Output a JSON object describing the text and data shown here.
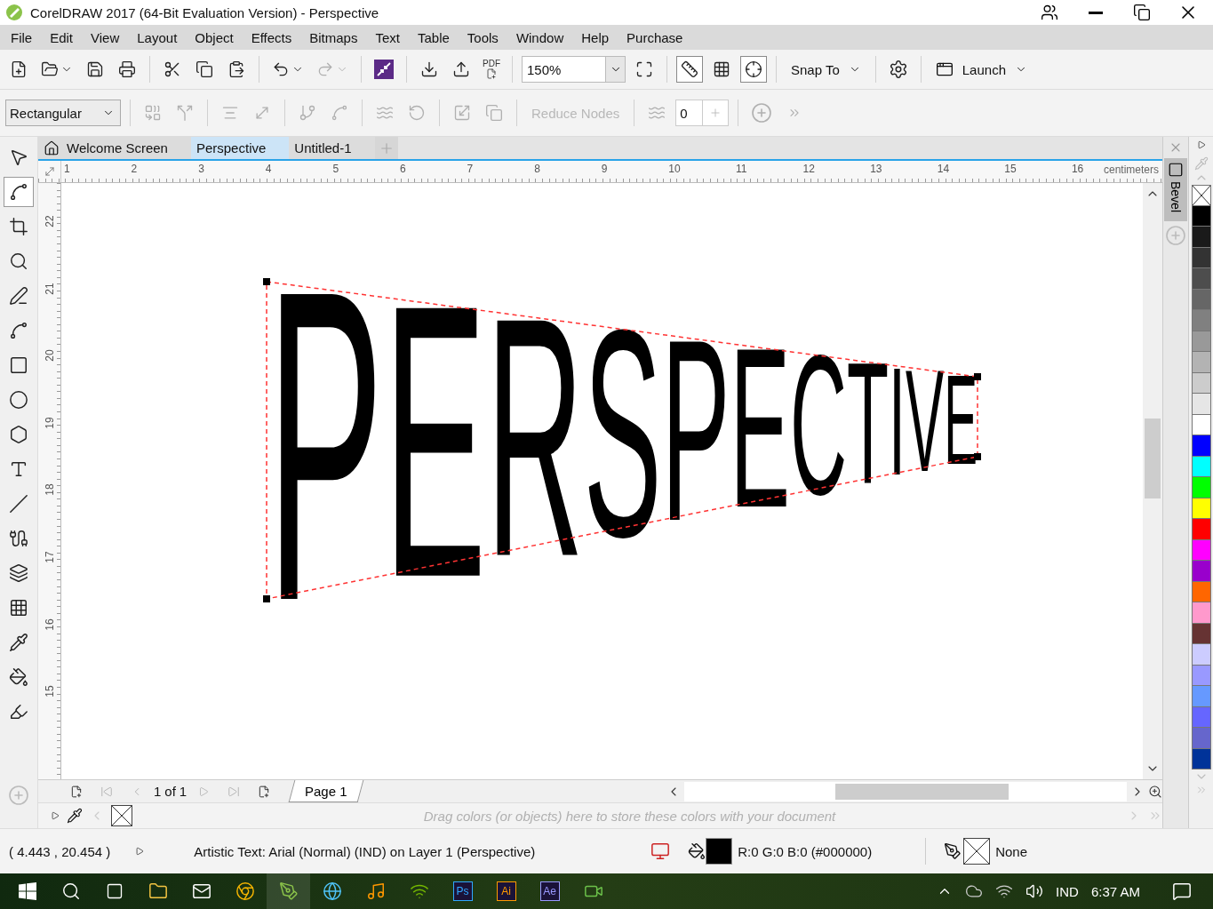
{
  "window": {
    "title": "CorelDRAW 2017 (64-Bit Evaluation Version) - Perspective"
  },
  "menu": [
    "File",
    "Edit",
    "View",
    "Layout",
    "Object",
    "Effects",
    "Bitmaps",
    "Text",
    "Table",
    "Tools",
    "Window",
    "Help",
    "Purchase"
  ],
  "toolbar": {
    "pdf": "PDF",
    "zoom": "150%",
    "toggles": [
      {
        "kind": "rulers",
        "on": true
      },
      {
        "kind": "grid",
        "on": false
      },
      {
        "kind": "guidelines",
        "on": true
      }
    ],
    "snap_to": "Snap To",
    "launch": "Launch"
  },
  "property_bar": {
    "mode": "Rectangular",
    "reduce_nodes": "Reduce Nodes",
    "value": "0"
  },
  "tabs": [
    {
      "label": "Welcome Screen",
      "kind": "home",
      "selected": false
    },
    {
      "label": "Perspective",
      "kind": "document",
      "selected": true
    },
    {
      "label": "Untitled-1",
      "kind": "document",
      "selected": false
    }
  ],
  "ruler": {
    "horizontal": [
      "1",
      "2",
      "3",
      "4",
      "5",
      "6",
      "7",
      "8",
      "9",
      "10",
      "11",
      "12",
      "13",
      "14",
      "15",
      "16"
    ],
    "unit": "centimeters",
    "vertical": [
      "22",
      "21",
      "20",
      "19",
      "18",
      "17",
      "16",
      "15"
    ]
  },
  "canvas": {
    "text": "PERSPECTIVE"
  },
  "docker": {
    "tab": "Bevel"
  },
  "palette": [
    {
      "color": "#000000"
    },
    {
      "color": "#1a1a1a"
    },
    {
      "color": "#333333"
    },
    {
      "color": "#4d4d4d"
    },
    {
      "color": "#666666"
    },
    {
      "color": "#808080"
    },
    {
      "color": "#999999"
    },
    {
      "color": "#b3b3b3"
    },
    {
      "color": "#cccccc"
    },
    {
      "color": "#e6e6e6"
    },
    {
      "color": "#ffffff"
    },
    {
      "color": "#0000ff"
    },
    {
      "color": "#00ffff"
    },
    {
      "color": "#00ff00"
    },
    {
      "color": "#ffff00"
    },
    {
      "color": "#ff0000"
    },
    {
      "color": "#ff00ff"
    },
    {
      "color": "#9900cc"
    },
    {
      "color": "#ff6600"
    },
    {
      "color": "#ff99cc"
    },
    {
      "color": "#663333"
    },
    {
      "color": "#ccccff"
    },
    {
      "color": "#9999ff"
    },
    {
      "color": "#6699ff"
    },
    {
      "color": "#6666ff"
    },
    {
      "color": "#6666cc"
    },
    {
      "color": "#003399"
    }
  ],
  "page_nav": {
    "current": "1",
    "of": "of",
    "total": "1",
    "page_tab": "Page 1"
  },
  "color_docker": {
    "hint": "Drag colors (or objects) here to store these colors with your document"
  },
  "status": {
    "coords": "( 4.443 , 20.454 )",
    "info": "Artistic Text: Arial (Normal) (IND) on Layer 1  (Perspective)",
    "fill": "R:0 G:0 B:0 (#000000)",
    "outline": "None"
  },
  "taskbar": {
    "apps": [
      {
        "label": "Ps",
        "color": "#31a8ff"
      },
      {
        "label": "Ai",
        "color": "#ff9a00"
      },
      {
        "label": "Ae",
        "color": "#9999ff"
      }
    ],
    "language": "IND",
    "time": "6:37 AM"
  }
}
